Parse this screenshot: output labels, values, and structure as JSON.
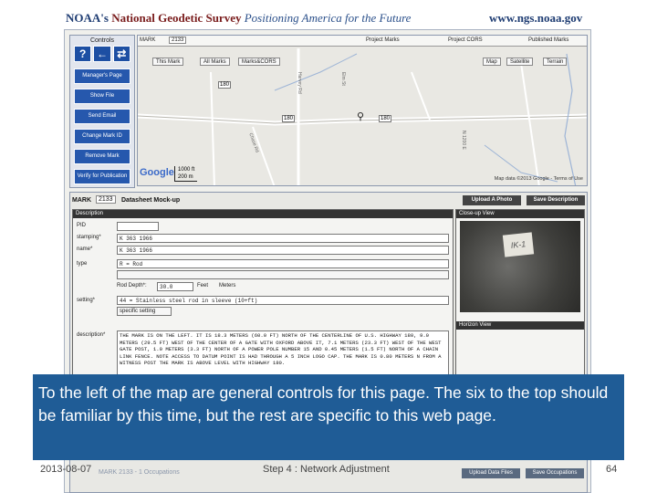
{
  "header": {
    "agency": "NOAA's",
    "name": "National Geodetic Survey",
    "tagline": "Positioning America for the Future",
    "url": "www.ngs.noaa.gov"
  },
  "controls": {
    "title": "Controls",
    "icons": [
      "?",
      "←",
      "⇄"
    ],
    "icon_names": [
      "help-icon",
      "back-arrow-icon",
      "swap-icon"
    ],
    "buttons": [
      "Manager's Page",
      "Show File",
      "Send Email",
      "Change Mark ID",
      "Remove Mark",
      "Verify for Publication"
    ]
  },
  "map": {
    "mark_label": "MARK",
    "mark_value": "2133",
    "checks": [
      "Project Marks",
      "Project CORS",
      "Published Marks"
    ],
    "subtabs": [
      "This Mark",
      "All Marks",
      "Marks&CORS"
    ],
    "maptypes": [
      "Map",
      "Satellite",
      "Terrain"
    ],
    "roads": [
      "180",
      "180",
      "180",
      "Harvey Rd",
      "Elm St",
      "Chase Rd",
      "N 1200 E"
    ],
    "scale_ft": "1000 ft",
    "scale_m": "200 m",
    "logo": "Google",
    "attribution": "Map data ©2013 Google - Terms of Use"
  },
  "datasheet": {
    "mark_label": "MARK",
    "mark_value": "2133",
    "title": "Datasheet Mock-up",
    "upload_btn": "Upload A Photo",
    "save_btn": "Save Description",
    "desc_header": "Description",
    "photo_header": "Close-up View",
    "horizon_header": "Horizon View",
    "photo_note": "IK-1",
    "fields": [
      {
        "label": "PID",
        "value": ""
      },
      {
        "label": "stamping*",
        "value": "K 363 1966"
      },
      {
        "label": "name*",
        "value": "K 363 1966"
      },
      {
        "label": "type",
        "value": "R = Rod"
      }
    ],
    "rod_depth_label": "Rod Depth*:",
    "rod_depth_value": "30.0",
    "feet_label": "Feet",
    "meters_label": "Meters",
    "setting_label": "setting*",
    "setting_value": "44 = Stainless steel rod in sleeve (10+ft)",
    "specific_setting": "specific setting",
    "description_label": "description*",
    "description_text": "THE MARK IS ON THE LEFT. IT IS 18.3 METERS (60.0 FT) NORTH OF THE CENTERLINE OF U.S. HIGHWAY 180, 9.0 METERS (29.5 FT) WEST OF THE CENTER OF A GATE WITH OXFORD ABOVE IT, 7.1 METERS (23.3 FT) WEST OF THE WEST GATE POST, 1.0 METERS (3.3 FT) NORTH OF A POWER POLE NUMBER 15 AND 0.45 METERS (1.5 FT) NORTH OF A CHAIN LINK FENCE. NOTE ACCESS TO DATUM POINT IS HAD THROUGH A 5 INCH LOGO CAP. THE MARK IS 0.80 METERS N FROM A WITNESS POST THE MARK IS ABOVE LEVEL WITH HIGHWAY 180."
  },
  "caption": "To the left of the map are general controls for this page. The six to the top should be familiar by this time, but the rest are specific to this web page.",
  "footer": {
    "date": "2013-08-07",
    "occupations": "MARK 2133 - 1 Occupations",
    "center": "Step 4 : Network Adjustment",
    "btn1": "Upload Data Files",
    "btn2": "Save Occupations",
    "page": "64"
  }
}
